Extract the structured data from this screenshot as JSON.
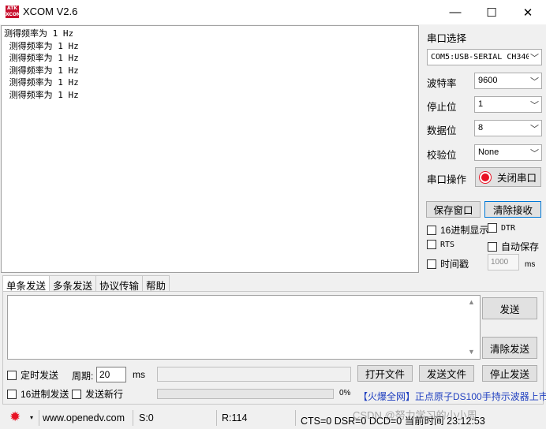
{
  "window": {
    "logo_text": "ATK XCOM",
    "title": "XCOM V2.6",
    "minimize": "—",
    "maximize": "☐",
    "close": "✕"
  },
  "receive": {
    "text": "测得频率为 1 Hz\n 测得频率为 1 Hz\n 测得频率为 1 Hz\n 测得频率为 1 Hz\n 测得频率为 1 Hz\n 测得频率为 1 Hz"
  },
  "port": {
    "select_label": "串口选择",
    "port_value": "COM5:USB-SERIAL CH340",
    "baud_label": "波特率",
    "baud_value": "9600",
    "stop_label": "停止位",
    "stop_value": "1",
    "data_label": "数据位",
    "data_value": "8",
    "parity_label": "校验位",
    "parity_value": "None",
    "op_label": "串口操作",
    "close_port": "关闭串口",
    "dropdown_arrow": "﹀"
  },
  "receive_controls": {
    "save_window": "保存窗口",
    "clear_receive": "清除接收",
    "hex_display": "16进制显示",
    "dtr": "DTR",
    "rts": "RTS",
    "auto_save": "自动保存",
    "timestamp": "时间戳",
    "timestamp_ms": "1000",
    "ms_unit": "ms"
  },
  "tabs": [
    "单条发送",
    "多条发送",
    "协议传输",
    "帮助"
  ],
  "send": {
    "send_button": "发送",
    "clear_send": "清除发送",
    "timed_send": "定时发送",
    "period_label": "周期:",
    "period_value": "20",
    "period_unit": "ms",
    "open_file": "打开文件",
    "send_file": "发送文件",
    "stop_send": "停止发送",
    "hex_send": "16进制发送",
    "newline_send": "发送新行",
    "progress_percent": 0,
    "progress_text": "0%",
    "ad_text": "【火爆全网】正点原子DS100手持示波器上市"
  },
  "status": {
    "gear_icon": "✹",
    "dropdown": "▾",
    "website": "www.openedv.com",
    "sent": "S:0",
    "received": "R:114",
    "lines": "CTS=0 DSR=0 DCD=0 当前时间 23:12:53"
  },
  "watermark": "CSDN @努力学习的小小周",
  "colors": {
    "accent": "#0078d7",
    "record_red": "#e81123",
    "ad_blue": "#2040c0"
  }
}
